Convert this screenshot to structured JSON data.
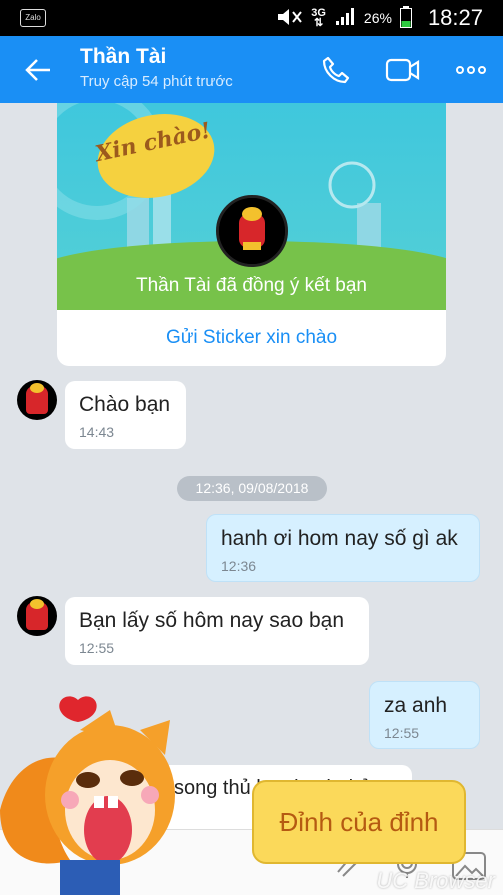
{
  "status_bar": {
    "app_icon_label": "Zalo",
    "network": "3G",
    "battery": "26%",
    "time": "18:27"
  },
  "header": {
    "title": "Thần Tài",
    "subtitle": "Truy cập 54 phút trước",
    "icons": [
      "back-arrow-icon",
      "phone-icon",
      "video-call-icon",
      "more-options-icon"
    ],
    "color": "#1a8ff5"
  },
  "friend_card": {
    "sign_text": "Xin chào!",
    "accepted_text": "Thần Tài đã đồng ý kết bạn",
    "sticker_link": "Gửi Sticker xin chào"
  },
  "messages": [
    {
      "direction": "in",
      "text": "Chào bạn",
      "time": "14:43"
    },
    {
      "direction": "out",
      "text": "hanh ơi hom nay số gì ak",
      "time": "12:36"
    },
    {
      "direction": "in",
      "text": "Bạn lấy số hôm nay sao bạn",
      "time": "12:55"
    },
    {
      "direction": "out",
      "text": "za anh",
      "time": "12:55"
    },
    {
      "direction": "in",
      "text": "song thủ hay bạch thủ",
      "time": ""
    }
  ],
  "date_divider": "12:36, 09/08/2018",
  "overlay": {
    "speech_text": "Đỉnh của đỉnh",
    "watermark": "UC Browser"
  }
}
